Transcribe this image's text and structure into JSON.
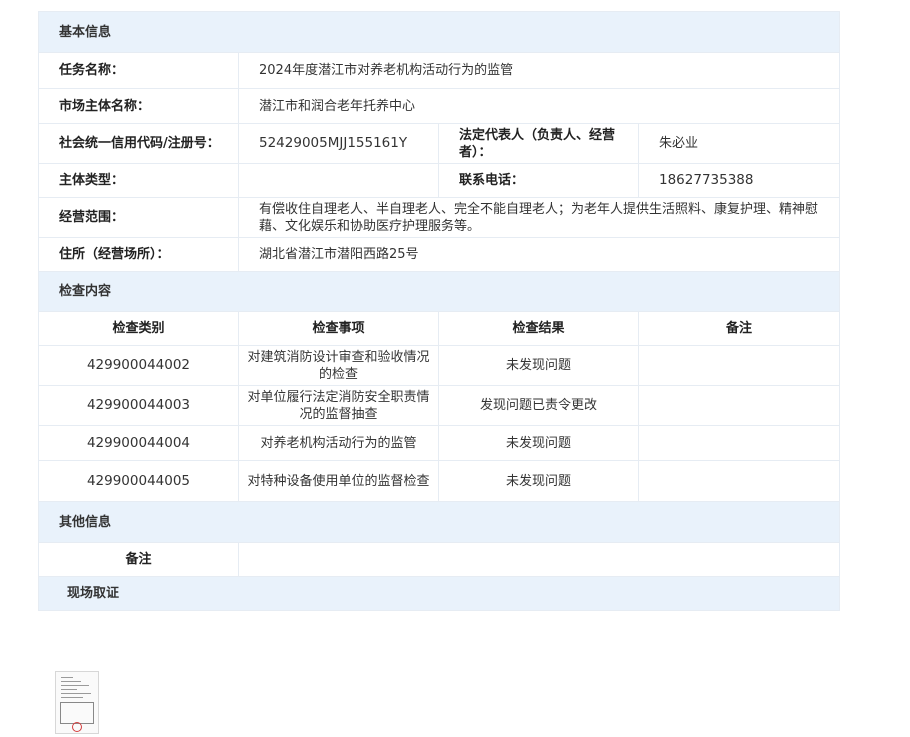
{
  "sections": {
    "basic": "基本信息",
    "check": "检查内容",
    "other": "其他信息",
    "scene": "现场取证"
  },
  "basic": {
    "task_label": "任务名称：",
    "task_value": "2024年度潜江市对养老机构活动行为的监管",
    "entity_label": "市场主体名称：",
    "entity_value": "潜江市和润合老年托养中心",
    "credit_label": "社会统一信用代码/注册号：",
    "credit_value": "52429005MJJ155161Y",
    "legal_label": "法定代表人（负责人、经营者）：",
    "legal_value": "朱必业",
    "type_label": "主体类型：",
    "type_value": "",
    "phone_label": "联系电话：",
    "phone_value": "18627735388",
    "scope_label": "经营范围：",
    "scope_value": "有偿收住自理老人、半自理老人、完全不能自理老人；为老年人提供生活照料、康复护理、精神慰藉、文化娱乐和协助医疗护理服务等。",
    "address_label": "住所（经营场所）：",
    "address_value": "湖北省潜江市潜阳西路25号"
  },
  "check": {
    "headers": [
      "检查类别",
      "检查事项",
      "检查结果",
      "备注"
    ],
    "rows": [
      {
        "code": "429900044002",
        "item": "对建筑消防设计审查和验收情况的检查",
        "result": "未发现问题",
        "note": ""
      },
      {
        "code": "429900044003",
        "item": "对单位履行法定消防安全职责情况的监督抽查",
        "result": "发现问题已责令更改",
        "note": ""
      },
      {
        "code": "429900044004",
        "item": "对养老机构活动行为的监管",
        "result": "未发现问题",
        "note": ""
      },
      {
        "code": "429900044005",
        "item": "对特种设备使用单位的监督检查",
        "result": "未发现问题",
        "note": ""
      }
    ]
  },
  "other": {
    "note_label": "备注",
    "note_value": ""
  },
  "evidence": {
    "thumbnail_icon": "document-thumbnail-icon"
  }
}
